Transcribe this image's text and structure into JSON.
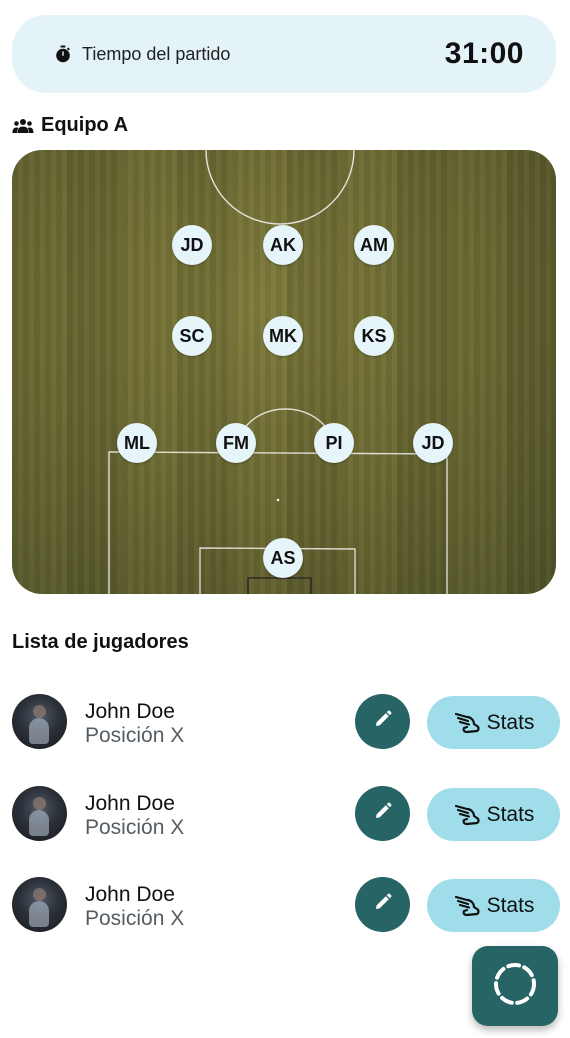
{
  "timer": {
    "label": "Tiempo del partido",
    "value": "31:00",
    "icon": "stopwatch-icon"
  },
  "team": {
    "name": "Equipo A",
    "icon": "group-icon",
    "field_colors": {
      "grass": "#6e6c34",
      "player_bubble": "#e6f5fa"
    },
    "formation": [
      {
        "initials": "JD",
        "line": "forward",
        "slot": "left"
      },
      {
        "initials": "AK",
        "line": "forward",
        "slot": "center"
      },
      {
        "initials": "AM",
        "line": "forward",
        "slot": "right"
      },
      {
        "initials": "SC",
        "line": "midfield",
        "slot": "left"
      },
      {
        "initials": "MK",
        "line": "midfield",
        "slot": "center"
      },
      {
        "initials": "KS",
        "line": "midfield",
        "slot": "right"
      },
      {
        "initials": "ML",
        "line": "defense",
        "slot": "left-wide"
      },
      {
        "initials": "FM",
        "line": "defense",
        "slot": "left-center"
      },
      {
        "initials": "PI",
        "line": "defense",
        "slot": "right-center"
      },
      {
        "initials": "JD",
        "line": "defense",
        "slot": "right-wide"
      },
      {
        "initials": "AS",
        "line": "goalkeeper",
        "slot": "center"
      }
    ]
  },
  "players_list": {
    "title": "Lista de jugadores",
    "items": [
      {
        "name": "John Doe",
        "position": "Posición X",
        "stats_label": "Stats"
      },
      {
        "name": "John Doe",
        "position": "Posición X",
        "stats_label": "Stats"
      },
      {
        "name": "John Doe",
        "position": "Posición X",
        "stats_label": "Stats"
      }
    ]
  },
  "colors": {
    "accent_dark": "#276466",
    "accent_light": "#9edde9",
    "timer_bg": "#e3f3f8"
  },
  "fab": {
    "icon": "dashed-circle-icon"
  }
}
